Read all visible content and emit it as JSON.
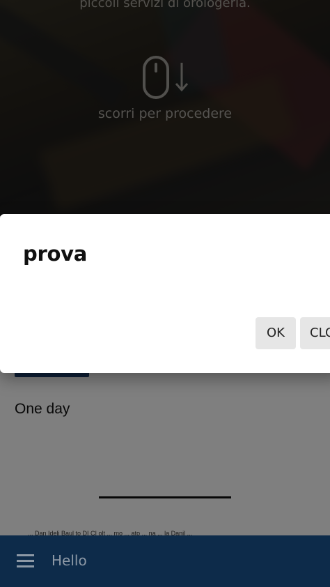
{
  "hero": {
    "subtitle": "piccoli servizi di orologeria.",
    "scroll_hint": "scorri per procedere",
    "scroll_icon": "mouse-scroll-down-icon"
  },
  "content": {
    "blue_button_label": "",
    "day_text": "One day",
    "footer_text": "... Dan Ideli Baul to DI CI olt ... mo ... ato ... na ... la Danil ..."
  },
  "dialog": {
    "title": "prova",
    "ok_label": "OK",
    "close_label": "CLOSE"
  },
  "app_bar": {
    "menu_icon": "hamburger-menu-icon",
    "title": "Hello"
  },
  "colors": {
    "app_bar": "#0d2b4a",
    "button_accent": "#1d3f6e",
    "dialog_button_bg": "#e6e6e6",
    "overlay": "rgba(0,0,0,0.5)"
  }
}
